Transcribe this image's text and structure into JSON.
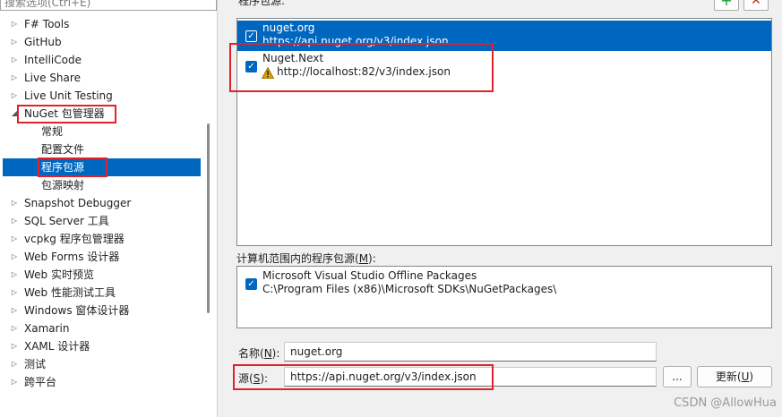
{
  "tree": {
    "search_placeholder": "搜索选项(Ctrl+E)",
    "items": [
      {
        "label": "F# Tools",
        "type": "collapsed"
      },
      {
        "label": "GitHub",
        "type": "collapsed"
      },
      {
        "label": "IntelliCode",
        "type": "collapsed"
      },
      {
        "label": "Live Share",
        "type": "collapsed"
      },
      {
        "label": "Live Unit Testing",
        "type": "collapsed"
      },
      {
        "label": "NuGet 包管理器",
        "type": "expanded"
      },
      {
        "label": "常规",
        "type": "child"
      },
      {
        "label": "配置文件",
        "type": "child"
      },
      {
        "label": "程序包源",
        "type": "child-selected"
      },
      {
        "label": "包源映射",
        "type": "child"
      },
      {
        "label": "Snapshot Debugger",
        "type": "collapsed"
      },
      {
        "label": "SQL Server 工具",
        "type": "collapsed"
      },
      {
        "label": "vcpkg 程序包管理器",
        "type": "collapsed"
      },
      {
        "label": "Web Forms 设计器",
        "type": "collapsed"
      },
      {
        "label": "Web 实时预览",
        "type": "collapsed"
      },
      {
        "label": "Web 性能测试工具",
        "type": "collapsed"
      },
      {
        "label": "Windows 窗体设计器",
        "type": "collapsed"
      },
      {
        "label": "Xamarin",
        "type": "collapsed"
      },
      {
        "label": "XAML 设计器",
        "type": "collapsed"
      },
      {
        "label": "测试",
        "type": "collapsed"
      },
      {
        "label": "跨平台",
        "type": "collapsed"
      }
    ]
  },
  "package_sources": {
    "label": "程序包源:",
    "add_button": "+",
    "remove_button": "✕",
    "items": [
      {
        "name": "nuget.org",
        "url": "https://api.nuget.org/v3/index.json",
        "checked": true,
        "selected": true,
        "warning": false
      },
      {
        "name": "Nuget.Next",
        "url": "http://localhost:82/v3/index.json",
        "checked": true,
        "selected": false,
        "warning": true
      }
    ]
  },
  "machine_sources": {
    "label": "计算机范围内的程序包源(",
    "label_key": "M",
    "label_end": "):",
    "items": [
      {
        "name": "Microsoft Visual Studio Offline Packages",
        "path": "C:\\Program Files (x86)\\Microsoft SDKs\\NuGetPackages\\",
        "checked": true
      }
    ]
  },
  "form": {
    "name_label": "名称(",
    "name_key": "N",
    "name_end": "):",
    "name_value": "nuget.org",
    "source_label": "源(",
    "source_key": "S",
    "source_end": "):",
    "source_value": "https://api.nuget.org/v3/index.json",
    "browse_button": "...",
    "update_button": "更新(",
    "update_key": "U",
    "update_end": ")"
  },
  "watermark": "CSDN @AllowHua",
  "colors": {
    "accent": "#0067c0",
    "highlight": "#e0222e",
    "warning": "#d4a300"
  }
}
